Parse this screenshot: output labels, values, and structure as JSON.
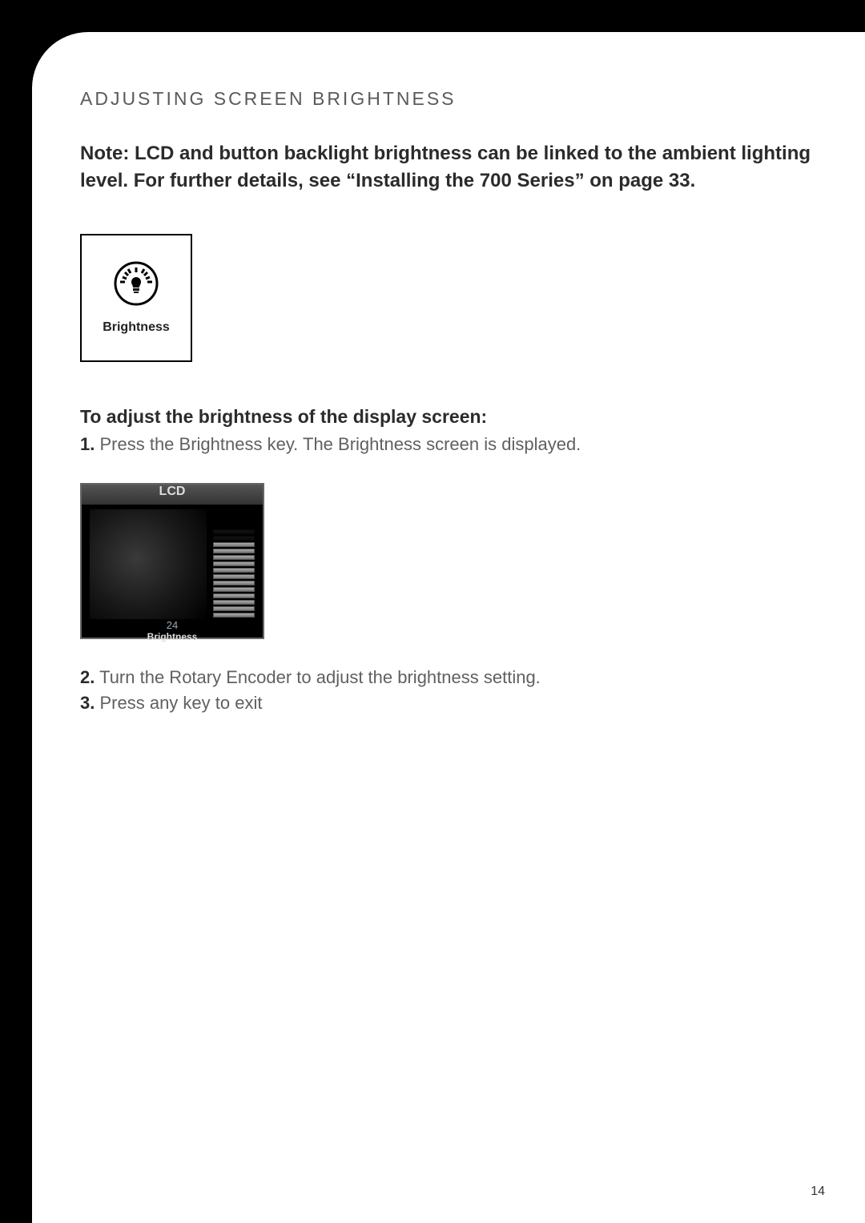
{
  "heading": "ADJUSTING SCREEN BRIGHTNESS",
  "note": "Note: LCD and button backlight brightness can be linked to the ambient lighting level. For further details, see “Installing the 700 Series” on page 33.",
  "icon_box": {
    "label": "Brightness"
  },
  "subheading": "To adjust the brightness of the display screen:",
  "steps": {
    "s1_num": "1.",
    "s1_text": "Press the Brightness key. The Brightness screen is displayed.",
    "s2_num": "2.",
    "s2_text": "Turn the Rotary Encoder to adjust the brightness setting.",
    "s3_num": "3.",
    "s3_text": "Press any key to exit"
  },
  "lcd_screenshot": {
    "title": "LCD",
    "value": "24",
    "caption": "Brightness"
  },
  "page_number": "14"
}
